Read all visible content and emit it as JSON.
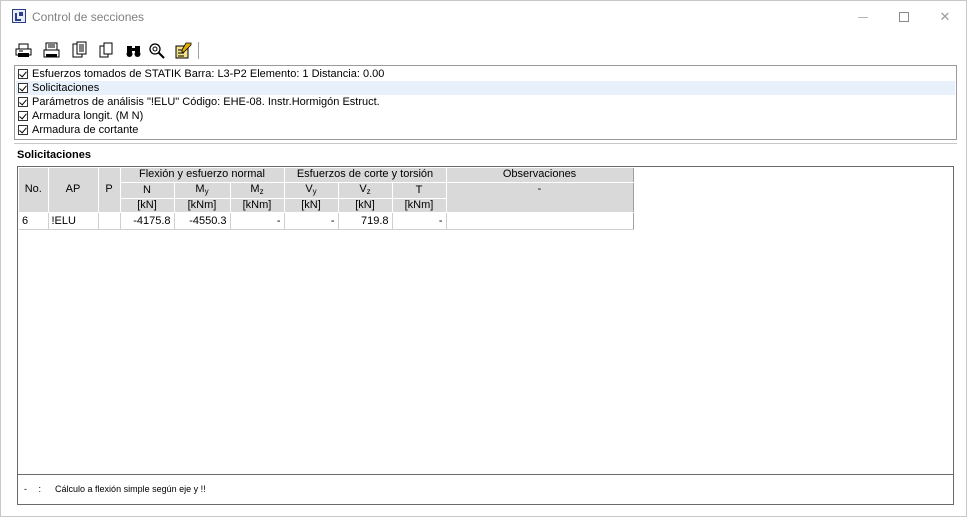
{
  "window": {
    "title": "Control de secciones",
    "minimize_glyph": "—",
    "maximize_glyph": "",
    "close_glyph": "✕"
  },
  "toolbar": {
    "buttons": [
      {
        "name": "print-icon"
      },
      {
        "name": "print-preview-icon"
      },
      {
        "name": "export-icon"
      },
      {
        "name": "copy-icon"
      },
      {
        "name": "binoculars-icon"
      },
      {
        "name": "search-settings-icon"
      },
      {
        "name": "edit-settings-icon"
      }
    ]
  },
  "info": {
    "rows": [
      {
        "label": "Esfuerzos tomados de STATIK   Barra: L3-P2   Elemento: 1   Distancia: 0.00",
        "checked": true
      },
      {
        "label": "Solicitaciones",
        "checked": true
      },
      {
        "label": "Parámetros de análisis \"!ELU\"   Código: EHE-08. Instr.Hormigón Estruct.",
        "checked": true
      },
      {
        "label": "Armadura longit. (M N)",
        "checked": true
      },
      {
        "label": "Armadura de cortante",
        "checked": true
      }
    ]
  },
  "section": {
    "title": "Solicitaciones"
  },
  "table": {
    "group_headers": {
      "flexion": "Flexión y esfuerzo normal",
      "corte": "Esfuerzos de corte y torsión",
      "observaciones": "Observaciones"
    },
    "columns": {
      "no": "No.",
      "ap": "AP",
      "p": "P",
      "n": "N",
      "my_base": "M",
      "my_sub": "y",
      "mz_base": "M",
      "mz_sub": "z",
      "vy_base": "V",
      "vy_sub": "y",
      "vz_base": "V",
      "vz_sub": "z",
      "t": "T",
      "obs_value": "-"
    },
    "units": {
      "n": "[kN]",
      "my": "[kNm]",
      "mz": "[kNm]",
      "vy": "[kN]",
      "vz": "[kN]",
      "t": "[kNm]"
    },
    "rows": [
      {
        "no": "6",
        "ap": "!ELU",
        "p": "",
        "n": "-4175.8",
        "my": "-4550.3",
        "mz": "-",
        "vy": "-",
        "vz": "719.8",
        "t": "-",
        "obs": ""
      }
    ]
  },
  "legend": {
    "symbol": "-",
    "colon": ":",
    "text": "Cálculo a flexión simple según eje y !!"
  },
  "colors": {
    "header_bg": "#d9d9d9",
    "highlight_row": "#e8f1fb",
    "border": "#6a6a6a"
  }
}
